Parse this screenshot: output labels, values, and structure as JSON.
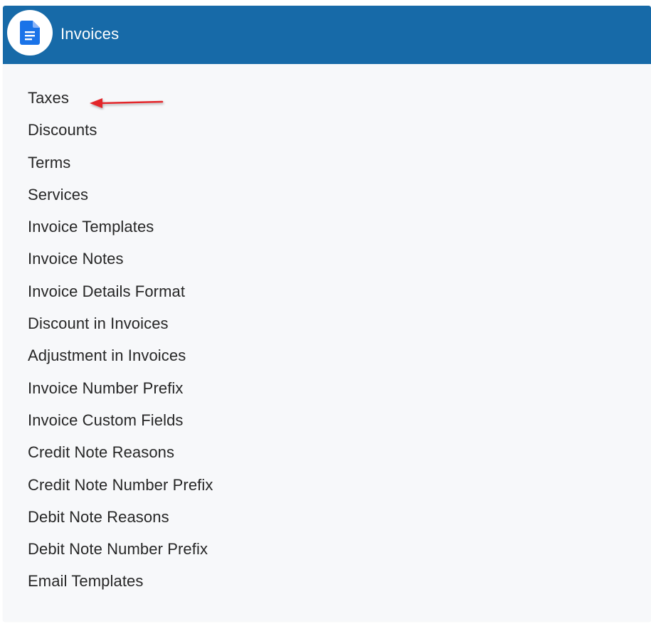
{
  "header": {
    "title": "Invoices",
    "icon": "document-icon",
    "color": "#176aa8"
  },
  "menu": {
    "items": [
      {
        "label": "Taxes"
      },
      {
        "label": "Discounts"
      },
      {
        "label": "Terms"
      },
      {
        "label": "Services"
      },
      {
        "label": "Invoice Templates"
      },
      {
        "label": "Invoice Notes"
      },
      {
        "label": "Invoice Details Format"
      },
      {
        "label": "Discount in Invoices"
      },
      {
        "label": "Adjustment in Invoices"
      },
      {
        "label": "Invoice Number Prefix"
      },
      {
        "label": "Invoice Custom Fields"
      },
      {
        "label": "Credit Note Reasons"
      },
      {
        "label": "Credit Note Number Prefix"
      },
      {
        "label": "Debit Note Reasons"
      },
      {
        "label": "Debit Note Number Prefix"
      },
      {
        "label": "Email Templates"
      }
    ]
  },
  "annotation": {
    "icon": "red-arrow-icon",
    "target": "Taxes",
    "color": "#e3262b"
  }
}
